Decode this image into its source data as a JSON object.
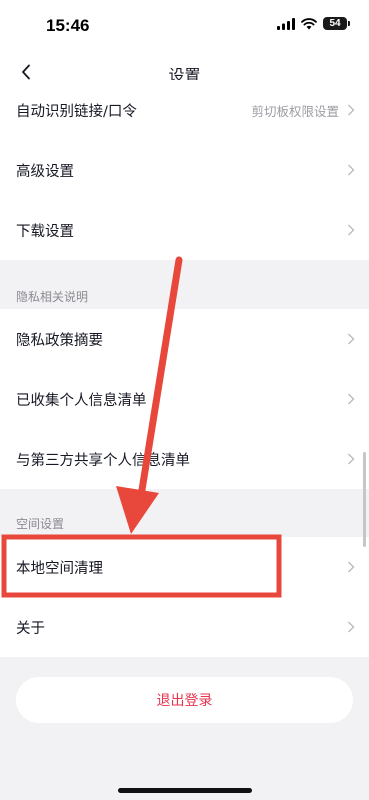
{
  "status_bar": {
    "time": "15:46",
    "battery": "54",
    "icons": [
      "signal-icon",
      "wifi-icon",
      "battery-icon"
    ]
  },
  "nav": {
    "back_icon": "chevron-left-icon",
    "title": "设置"
  },
  "groups": [
    {
      "header": "",
      "items": [
        {
          "label": "自动识别链接/口令",
          "hint": "剪切板权限设置"
        },
        {
          "label": "高级设置",
          "hint": ""
        },
        {
          "label": "下载设置",
          "hint": ""
        }
      ]
    },
    {
      "header": "隐私相关说明",
      "items": [
        {
          "label": "隐私政策摘要",
          "hint": ""
        },
        {
          "label": "已收集个人信息清单",
          "hint": ""
        },
        {
          "label": "与第三方共享个人信息清单",
          "hint": ""
        }
      ]
    },
    {
      "header": "空间设置",
      "items": [
        {
          "label": "本地空间清理",
          "hint": ""
        },
        {
          "label": "关于",
          "hint": ""
        }
      ]
    }
  ],
  "logout": {
    "label": "退出登录"
  },
  "annotation": {
    "color": "#e8473b",
    "shapes": [
      "arrow",
      "highlight-box"
    ]
  }
}
